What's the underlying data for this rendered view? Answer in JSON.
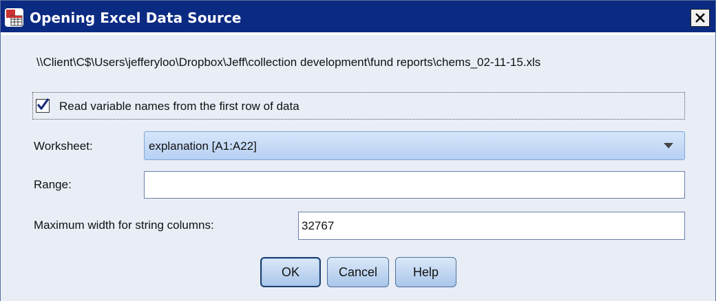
{
  "window": {
    "title": "Opening Excel Data Source",
    "close_label": "×"
  },
  "file_path": "\\\\Client\\C$\\Users\\jefferyloo\\Dropbox\\Jeff\\collection development\\fund reports\\chems_02-11-15.xls",
  "read_names": {
    "label": "Read variable names from the first row of data",
    "checked": true
  },
  "worksheet": {
    "label": "Worksheet:",
    "value": "explanation [A1:A22]"
  },
  "range": {
    "label": "Range:",
    "value": ""
  },
  "max_width": {
    "label": "Maximum width for string columns:",
    "value": "32767"
  },
  "buttons": {
    "ok": "OK",
    "cancel": "Cancel",
    "help": "Help"
  },
  "icons": {
    "app": "spss-data-table-icon",
    "close": "close-x-icon",
    "check": "checkmark-icon",
    "dropdown": "dropdown-arrow-icon"
  },
  "colors": {
    "titlebar": "#0b2a82",
    "dialog_bg": "#e8edf6",
    "combo_bg": "#c6dbf7",
    "button_bg": "#c2d8f2"
  }
}
